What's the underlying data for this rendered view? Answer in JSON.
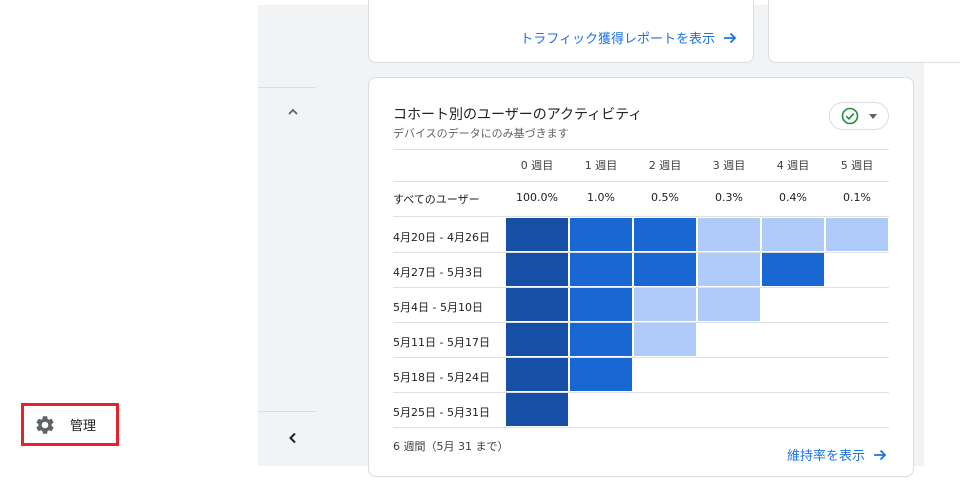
{
  "sidebar": {
    "admin_label": "管理"
  },
  "traffic_card": {
    "link_label": "トラフィック獲得レポートを表示"
  },
  "cohort_card": {
    "title": "コホート別のユーザーのアクティビティ",
    "subtitle": "デバイスのデータにのみ基づきます",
    "weeks": [
      "0 週目",
      "1 週目",
      "2 週目",
      "3 週目",
      "4 週目",
      "5 週目"
    ],
    "all_users": {
      "label": "すべてのユーザー",
      "values": [
        "100.0%",
        "1.0%",
        "0.5%",
        "0.3%",
        "0.4%",
        "0.1%"
      ]
    },
    "rows": [
      {
        "label": "4月20日 - 4月26日",
        "cells": [
          3,
          2,
          2,
          1,
          1,
          1
        ]
      },
      {
        "label": "4月27日 - 5月3日",
        "cells": [
          3,
          2,
          2,
          1,
          2
        ]
      },
      {
        "label": "5月4日 - 5月10日",
        "cells": [
          3,
          2,
          1,
          1
        ]
      },
      {
        "label": "5月11日 - 5月17日",
        "cells": [
          3,
          2,
          1
        ]
      },
      {
        "label": "5月18日 - 5月24日",
        "cells": [
          3,
          2
        ]
      },
      {
        "label": "5月25日 - 5月31日",
        "cells": [
          3
        ]
      }
    ],
    "footnote": "6 週間（5月 31 まで）",
    "retention_link_label": "維持率を表示"
  },
  "colors": {
    "level_3": "#174ea6",
    "level_2": "#1967d2",
    "level_1": "#aecbfa",
    "link": "#1a73e8",
    "check": "#1e8e3e",
    "highlight_border": "#e3222b"
  },
  "icons": {
    "admin": "gear-icon",
    "collapse": "chevron-up-icon",
    "back": "chevron-left-icon",
    "link_arrow": "arrow-right-icon",
    "compare": "check-circle-icon"
  }
}
